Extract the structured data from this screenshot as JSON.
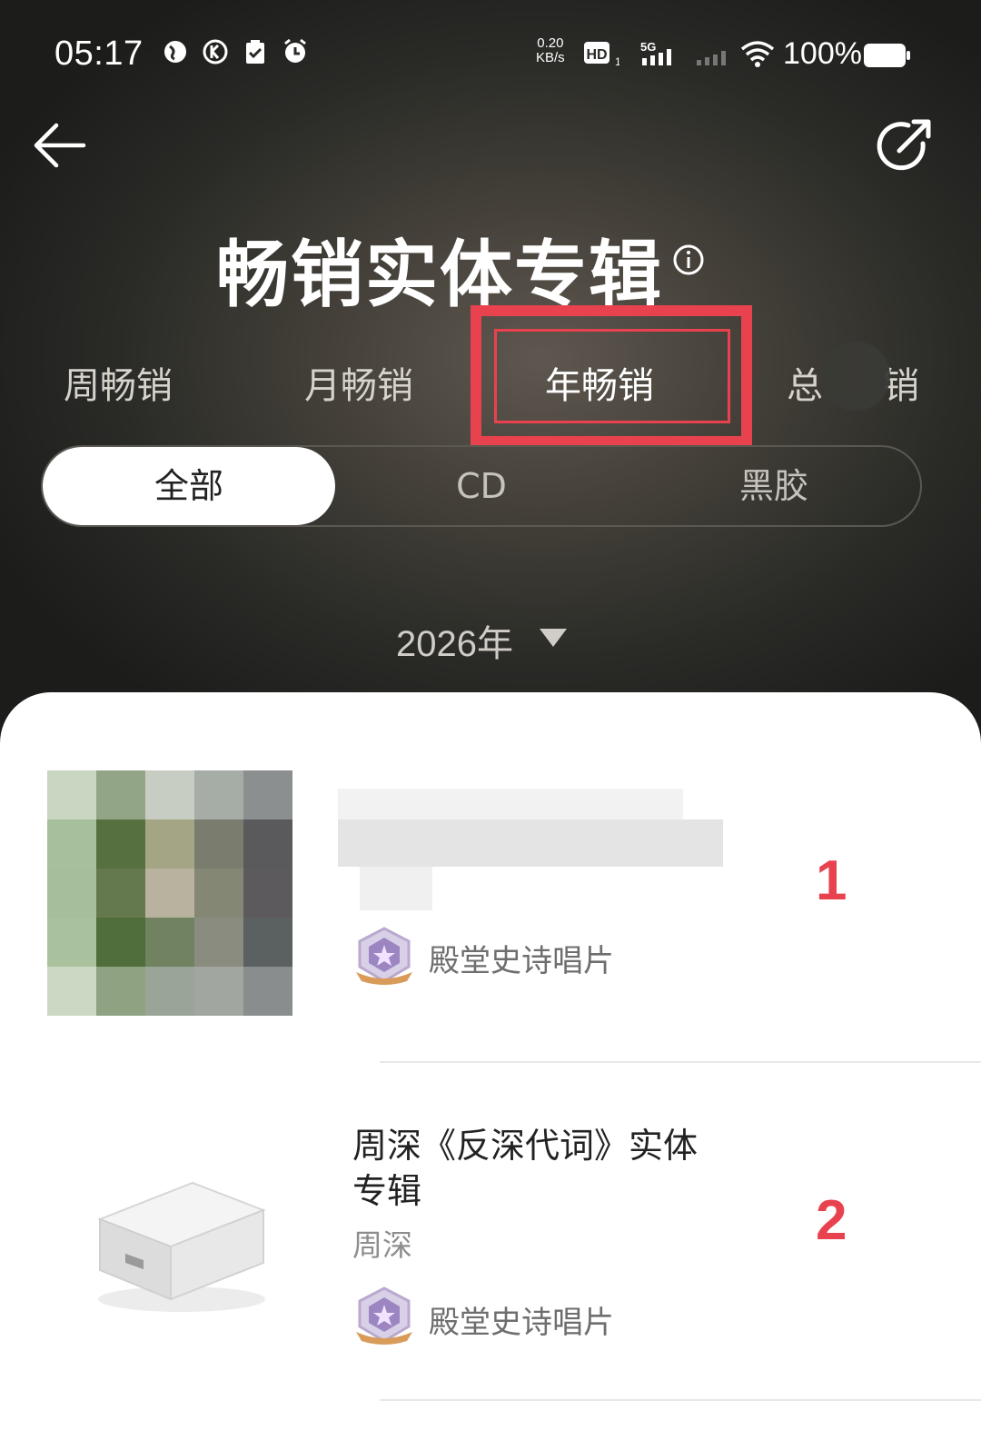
{
  "status": {
    "time": "05:17",
    "net_speed_top": "0.20",
    "net_speed_bottom": "KB/s",
    "hd": "HD",
    "hd_sub": "1",
    "signal_type": "5G",
    "battery": "100%"
  },
  "header": {
    "back_icon": "arrow-left-icon",
    "share_icon": "share-icon",
    "title": "畅销实体专辑",
    "info_icon": "info-icon"
  },
  "tabs": [
    {
      "label": "周畅销",
      "active": false
    },
    {
      "label": "月畅销",
      "active": false
    },
    {
      "label": "年畅销",
      "active": true
    },
    {
      "label": "总",
      "active": false
    },
    {
      "label": "销",
      "active": false
    }
  ],
  "segments": [
    {
      "label": "全部",
      "selected": true
    },
    {
      "label": "CD",
      "selected": false
    },
    {
      "label": "黑胶",
      "selected": false
    }
  ],
  "year_selector": {
    "label": "2026年",
    "icon": "caret-down-icon"
  },
  "list": [
    {
      "rank": "1",
      "name": "",
      "artist": "",
      "badge": "殿堂史诗唱片"
    },
    {
      "rank": "2",
      "name_line1": "周深《反深代词》实体",
      "name_line2": "专辑",
      "artist": "周深",
      "badge": "殿堂史诗唱片"
    }
  ],
  "colors": {
    "accent": "#e8424f",
    "hero_bg": "#2a2b27",
    "sheet_bg": "#ffffff"
  }
}
